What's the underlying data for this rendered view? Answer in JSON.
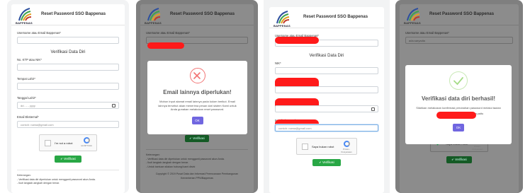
{
  "brand": "BAPPENAS",
  "title": "Reset Password SSO Bappenas",
  "labels": {
    "username": "Username atau Email Bappenas*",
    "verifikasi": "Verifikasi Data Diri",
    "ktp": "No. KTP atau NIK*",
    "nik": "NIK*",
    "tempat_lahir": "Tempat Lahir*",
    "tanggal_lahir": "Tanggal Lahir*",
    "email_eksternal": "Email Eksternal*"
  },
  "placeholders": {
    "date": "dd - - - yyyy",
    "email": "contoh: nama@gmail.com"
  },
  "values": {
    "username_p4": "ada.saryadia"
  },
  "captcha": {
    "unchecked_label": "I'm not a robot",
    "checked_label": "Saya bukan robot",
    "brand": "reCAPTCHA",
    "links": "Privasi - Persyaratan"
  },
  "verify_button": "Verifikasi",
  "footer": {
    "heading": "Keterangan:",
    "line1": "- Verifikasi data diri diperlukan untuk mengganti password akun Anda.",
    "line2": "- Ikuti langkah-langkah dengan benar.",
    "line3": "- Untuk bantuan silakan hubungi kami disini",
    "link": "disini",
    "copyright1": "Copyright © 2019 Pusat Data dan Informasi Perencanaan Pembangunan",
    "copyright2": "Kementerian PPN/Bappenas"
  },
  "modal_error": {
    "title": "Email lainnya diperlukan!",
    "text": "Mohon input alamat email lainnya pada kolom berikut. Email lainnya tersebut akan menerima pesan dari sistem Kami untuk Anda gunakan melakukan reset password.",
    "button": "OK"
  },
  "modal_success": {
    "title": "Verifikasi data diri berhasil!",
    "text_before": "Silahkan melakukan konfirmasi perubahan password melalui tautan",
    "text_after": "email Anda yaitu",
    "button": "OK"
  },
  "colors": {
    "error": "#f27474",
    "success": "#a5dc86",
    "ok_button": "#7066e0",
    "verify_button": "#28a745",
    "redact": "#ff1a1a"
  }
}
